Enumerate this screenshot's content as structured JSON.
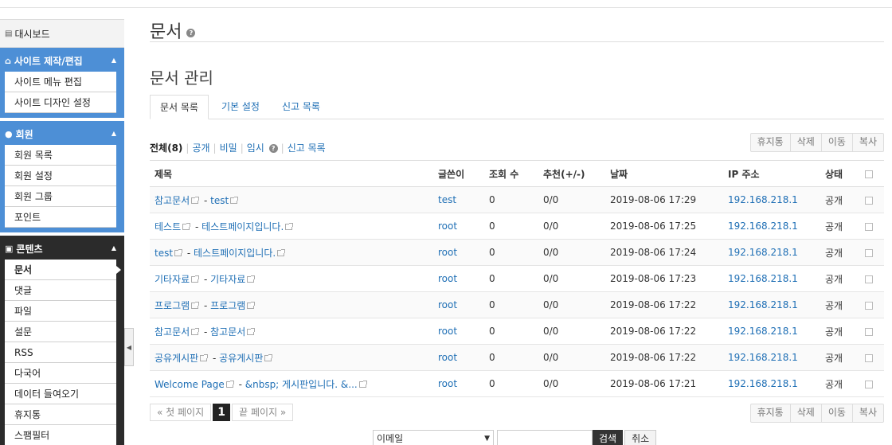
{
  "sidebar": {
    "dashboard": "대시보드",
    "groups": [
      {
        "title": "사이트 제작/편집",
        "items": [
          "사이트 메뉴 편집",
          "사이트 디자인 설정"
        ]
      },
      {
        "title": "회원",
        "items": [
          "회원 목록",
          "회원 설정",
          "회원 그룹",
          "포인트"
        ]
      },
      {
        "title": "콘텐츠",
        "items": [
          "문서",
          "댓글",
          "파일",
          "설문",
          "RSS",
          "다국어",
          "데이터 들여오기",
          "휴지통",
          "스팸필터"
        ]
      }
    ]
  },
  "header": {
    "title": "문서",
    "help": "?"
  },
  "section": {
    "title": "문서 관리",
    "tabs": [
      "문서 목록",
      "기본 설정",
      "신고 목록"
    ]
  },
  "filters": {
    "all": "전체(8)",
    "public": "공개",
    "secret": "비밀",
    "temp": "임시",
    "temp_help": "?",
    "reports": "신고 목록"
  },
  "actions": [
    "휴지통",
    "삭제",
    "이동",
    "복사"
  ],
  "table": {
    "headers": [
      "제목",
      "글쓴이",
      "조회 수",
      "추천(+/-)",
      "날짜",
      "IP 주소",
      "상태"
    ],
    "rows": [
      {
        "board": "참고문서",
        "title": "test",
        "author": "test",
        "views": "0",
        "votes": "0/0",
        "date": "2019-08-06 17:29",
        "ip": "192.168.218.1",
        "status": "공개"
      },
      {
        "board": "테스트",
        "title": "테스트페이지입니다.",
        "author": "root",
        "views": "0",
        "votes": "0/0",
        "date": "2019-08-06 17:25",
        "ip": "192.168.218.1",
        "status": "공개"
      },
      {
        "board": "test",
        "title": "테스트페이지입니다.",
        "author": "root",
        "views": "0",
        "votes": "0/0",
        "date": "2019-08-06 17:24",
        "ip": "192.168.218.1",
        "status": "공개"
      },
      {
        "board": "기타자료",
        "title": "기타자료",
        "author": "root",
        "views": "0",
        "votes": "0/0",
        "date": "2019-08-06 17:23",
        "ip": "192.168.218.1",
        "status": "공개"
      },
      {
        "board": "프로그램",
        "title": "프로그램",
        "author": "root",
        "views": "0",
        "votes": "0/0",
        "date": "2019-08-06 17:22",
        "ip": "192.168.218.1",
        "status": "공개"
      },
      {
        "board": "참고문서",
        "title": "참고문서",
        "author": "root",
        "views": "0",
        "votes": "0/0",
        "date": "2019-08-06 17:22",
        "ip": "192.168.218.1",
        "status": "공개"
      },
      {
        "board": "공유게시판",
        "title": "공유게시판",
        "author": "root",
        "views": "0",
        "votes": "0/0",
        "date": "2019-08-06 17:22",
        "ip": "192.168.218.1",
        "status": "공개"
      },
      {
        "board": "Welcome Page",
        "title": "&nbsp; 게시판입니다. &...",
        "author": "root",
        "views": "0",
        "votes": "0/0",
        "date": "2019-08-06 17:21",
        "ip": "192.168.218.1",
        "status": "공개"
      }
    ]
  },
  "pager": {
    "first": "« 첫 페이지",
    "current": "1",
    "last": "끝 페이지 »"
  },
  "search": {
    "field": "이메일",
    "submit": "검색",
    "cancel": "취소"
  },
  "colors": {
    "sidebar_blue": "#4d8fd6",
    "sidebar_dark": "#2b2b2b",
    "link": "#1f6fb5"
  }
}
